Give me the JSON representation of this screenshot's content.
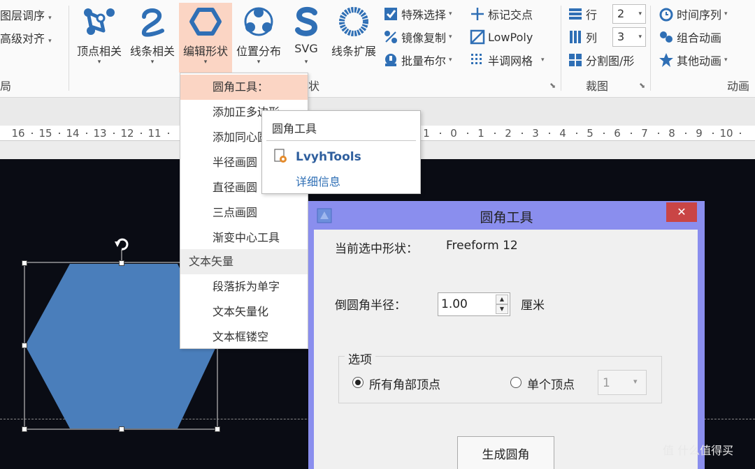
{
  "ribbon": {
    "left_cmds": [
      "图层调序",
      "高级对齐"
    ],
    "left_group_label": "局",
    "big_buttons": [
      {
        "label": "顶点相关",
        "icon": "vertex-icon"
      },
      {
        "label": "线条相关",
        "icon": "curve-icon"
      },
      {
        "label": "编辑形状",
        "icon": "hexagon-icon"
      },
      {
        "label": "位置分布",
        "icon": "distribute-icon"
      },
      {
        "label": "SVG",
        "icon": "svg-icon"
      },
      {
        "label": "线条扩展",
        "icon": "ring-icon"
      }
    ],
    "shape_group_label_tail": "状",
    "small_col1": [
      "特殊选择",
      "镜像复制",
      "批量布尔"
    ],
    "small_col2": [
      "标记交点",
      "LowPoly",
      "半调网格"
    ],
    "crop": {
      "row_label": "行",
      "row_value": "2",
      "col_label": "列",
      "col_value": "3",
      "split_label": "分割图/形",
      "group_label": "裁图"
    },
    "anim": {
      "items": [
        "时间序列",
        "组合动画",
        "其他动画"
      ],
      "group_label": "动画"
    },
    "accent": "#fbd5c4"
  },
  "ruler": {
    "left_numbers": [
      "16",
      "15",
      "14",
      "13",
      "12",
      "11"
    ],
    "right_numbers": [
      "1",
      "0",
      "1",
      "2",
      "3",
      "4",
      "5",
      "6",
      "7",
      "8",
      "9",
      "10"
    ]
  },
  "dropdown": {
    "items": [
      "圆角工具：",
      "添加正多边形",
      "添加同心圆",
      "半径画圆",
      "直径画圆",
      "三点画圆",
      "渐变中心工具"
    ],
    "section_header": "文本矢量",
    "text_items": [
      "段落拆为单字",
      "文本矢量化",
      "文本框镂空"
    ]
  },
  "tooltip": {
    "title": "圆角工具",
    "addin": "LvyhTools",
    "link": "详细信息"
  },
  "dialog": {
    "title": "圆角工具",
    "close": "✕",
    "current_label": "当前选中形状：",
    "current_value": "Freeform 12",
    "radius_label": "倒圆角半径：",
    "radius_value": "1.00",
    "unit": "厘米",
    "options_label": "选项",
    "radio_all": "所有角部顶点",
    "radio_single": "单个顶点",
    "single_value": "1",
    "generate_button": "生成圆角"
  },
  "shape": {
    "fill": "#4a7ebb"
  },
  "watermark": "值 什么值得买"
}
